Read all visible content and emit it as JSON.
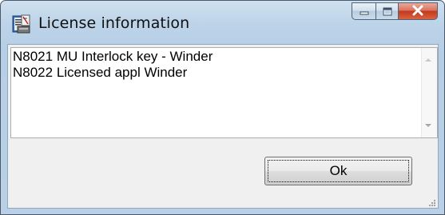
{
  "window": {
    "title": "License information",
    "icon": "license-app-icon"
  },
  "caption_buttons": {
    "minimize_icon": "minimize-icon",
    "maximize_icon": "maximize-icon",
    "close_icon": "close-icon"
  },
  "list": {
    "items": [
      "N8021 MU Interlock key - Winder",
      "N8022 Licensed appl Winder"
    ]
  },
  "buttons": {
    "ok_label": "Ok"
  },
  "colors": {
    "client_bg": "#f0f0f0",
    "close_red": "#c3391e",
    "frame_blue": "#b9d0e6"
  }
}
